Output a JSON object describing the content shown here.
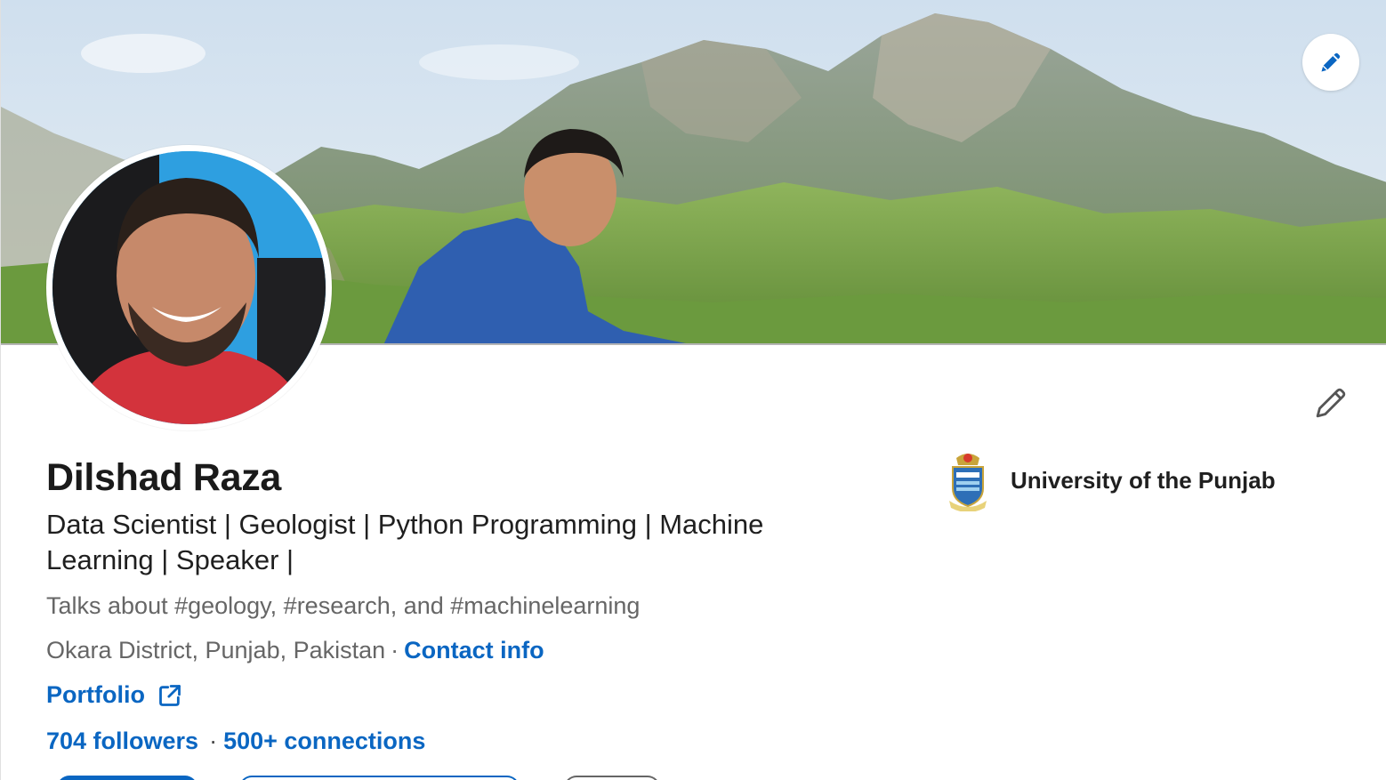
{
  "profile": {
    "name": "Dilshad Raza",
    "headline": "Data Scientist | Geologist | Python Programming | Machine Learning | Speaker |",
    "talks_about": "Talks about #geology, #research, and #machinelearning",
    "location": "Okara District, Punjab, Pakistan",
    "location_separator": "·",
    "contact_info": "Contact info",
    "portfolio_label": "Portfolio",
    "followers": "704 followers",
    "network_separator": "·",
    "connections": "500+ connections"
  },
  "education": {
    "name": "University of the Punjab",
    "logo_icon": "university-crest-icon"
  },
  "icons": {
    "banner_edit": "pencil-icon",
    "intro_edit": "pencil-icon",
    "portfolio_external": "external-link-icon"
  },
  "colors": {
    "link_blue": "#0a66c2",
    "secondary_text": "#666666",
    "primary_text": "#1f1f1f",
    "banner_sky": "#d9e6f2",
    "avatar_bg": "#2e9fe0"
  }
}
